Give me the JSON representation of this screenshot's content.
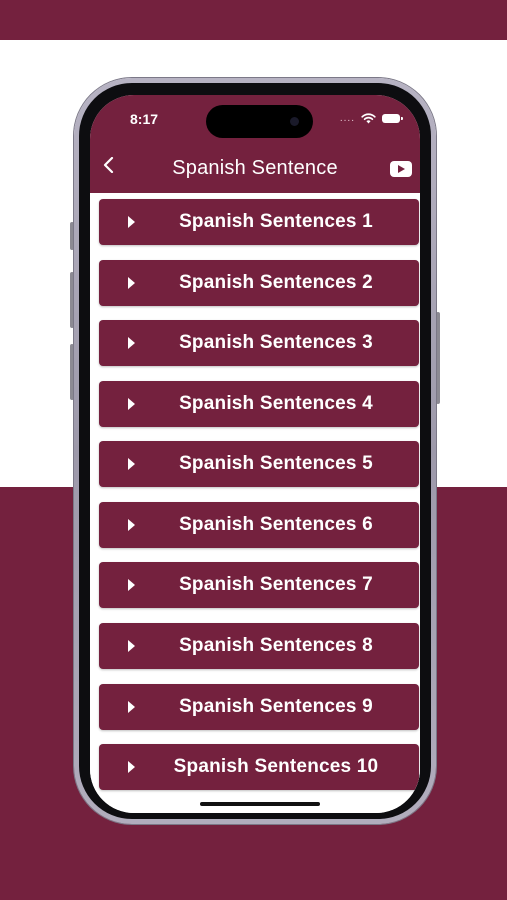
{
  "status_bar": {
    "time": "8:17",
    "signal": "....",
    "icons": [
      "wifi-icon",
      "battery-icon"
    ]
  },
  "header": {
    "title": "Spanish Sentence",
    "back_icon": "chevron-left-icon",
    "video_icon": "youtube-icon"
  },
  "list": {
    "items": [
      {
        "label": "Spanish Sentences 1"
      },
      {
        "label": "Spanish Sentences 2"
      },
      {
        "label": "Spanish Sentences 3"
      },
      {
        "label": "Spanish Sentences 4"
      },
      {
        "label": "Spanish Sentences 5"
      },
      {
        "label": "Spanish Sentences 6"
      },
      {
        "label": "Spanish Sentences 7"
      },
      {
        "label": "Spanish Sentences 8"
      },
      {
        "label": "Spanish Sentences 9"
      },
      {
        "label": "Spanish Sentences 10"
      }
    ]
  },
  "colors": {
    "accent": "#74213e",
    "list_background": "#ffffff",
    "page_background": "#ffffff"
  }
}
